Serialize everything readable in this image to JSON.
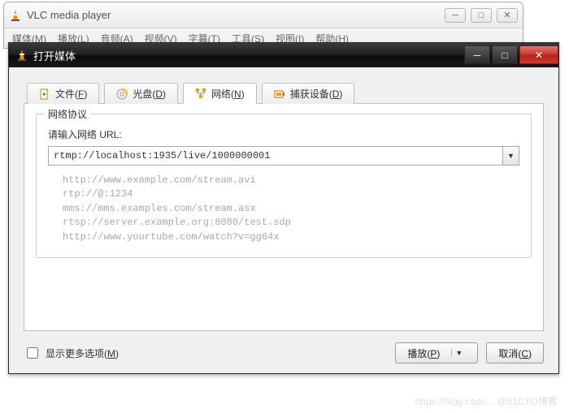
{
  "main_window": {
    "title": "VLC media player",
    "menu": [
      "媒体(M)",
      "播放(L)",
      "音频(A)",
      "视频(V)",
      "字幕(T)",
      "工具(S)",
      "视图(I)",
      "帮助(H)"
    ]
  },
  "dialog": {
    "title": "打开媒体",
    "tabs": {
      "file": {
        "label": "文件(",
        "mn": "F",
        "tail": ")"
      },
      "disc": {
        "label": "光盘(",
        "mn": "D",
        "tail": ")"
      },
      "network": {
        "label": "网络(",
        "mn": "N",
        "tail": ")"
      },
      "capture": {
        "label": "捕获设备(",
        "mn": "D",
        "tail": ")"
      }
    },
    "group_title": "网络协议",
    "url_label": "请输入网络 URL:",
    "url_value": "rtmp://localhost:1935/live/1000000001",
    "examples": "http://www.example.com/stream.avi\nrtp://@:1234\nmms://mms.examples.com/stream.asx\nrtsp://server.example.org:8080/test.sdp\nhttp://www.yourtube.com/watch?v=gg64x",
    "more_options": {
      "label": "显示更多选项(",
      "mn": "M",
      "tail": ")",
      "checked": false
    },
    "play_btn": {
      "label": "播放(",
      "mn": "P",
      "tail": ")"
    },
    "cancel_btn": {
      "label": "取消(",
      "mn": "C",
      "tail": ")"
    }
  },
  "watermark": "https://blog.csdn... @51CTO博客"
}
